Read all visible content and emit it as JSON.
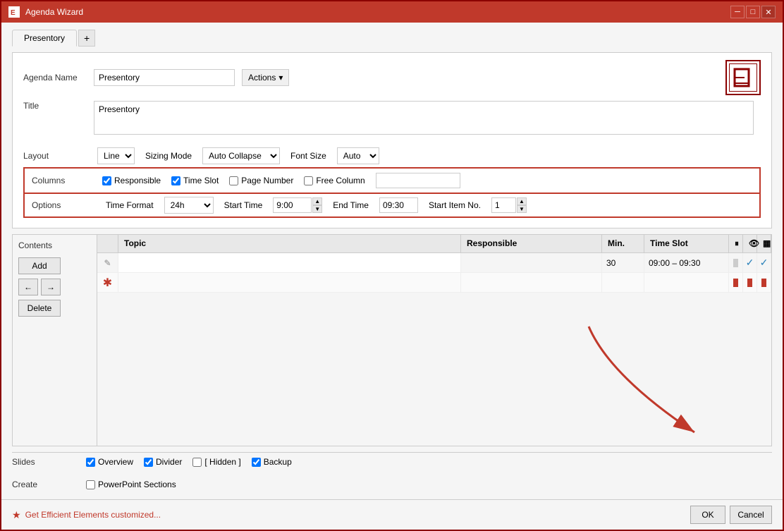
{
  "window": {
    "title": "Agenda Wizard",
    "title_icon": "E",
    "min_btn": "─",
    "max_btn": "□",
    "close_btn": "✕"
  },
  "tabs": [
    {
      "label": "Presentory",
      "active": true
    }
  ],
  "add_tab_label": "+",
  "form": {
    "agenda_name_label": "Agenda Name",
    "agenda_name_value": "Presentory",
    "actions_label": "Actions",
    "actions_arrow": "▾",
    "title_label": "Title",
    "title_value": "Presentory"
  },
  "layout": {
    "label": "Layout",
    "layout_value": "Line",
    "sizing_mode_label": "Sizing Mode",
    "sizing_mode_value": "Auto Collapse",
    "font_size_label": "Font Size",
    "font_size_value": "Auto"
  },
  "columns": {
    "label": "Columns",
    "responsible_label": "Responsible",
    "responsible_checked": true,
    "time_slot_label": "Time Slot",
    "time_slot_checked": true,
    "page_number_label": "Page Number",
    "page_number_checked": false,
    "free_column_label": "Free Column",
    "free_column_checked": false,
    "free_column_input": ""
  },
  "options": {
    "label": "Options",
    "time_format_label": "Time Format",
    "time_format_value": "24h",
    "start_time_label": "Start Time",
    "start_time_value": "9:00",
    "end_time_label": "End Time",
    "end_time_value": "09:30",
    "start_item_label": "Start Item No.",
    "start_item_value": "1"
  },
  "contents": {
    "label": "Contents",
    "add_btn": "Add",
    "left_arrow": "←",
    "right_arrow": "→",
    "delete_btn": "Delete",
    "table_headers": {
      "icon_col": "",
      "topic_col": "Topic",
      "responsible_col": "Responsible",
      "min_col": "Min.",
      "time_slot_col": "Time Slot",
      "pause_col": "⏸",
      "eye_col": "👁",
      "grid_col": "▦"
    },
    "rows": [
      {
        "icon": "✎",
        "topic": "",
        "responsible": "",
        "min": "30",
        "time_slot": "09:00 – 09:30",
        "pause": false,
        "eye": true,
        "grid": true,
        "is_new": false
      },
      {
        "icon": "✱",
        "topic": "",
        "responsible": "",
        "min": "",
        "time_slot": "",
        "pause": false,
        "eye": false,
        "grid": false,
        "is_new": true
      }
    ]
  },
  "slides": {
    "label": "Slides",
    "overview_label": "Overview",
    "overview_checked": true,
    "divider_label": "Divider",
    "divider_checked": true,
    "hidden_label": "[ Hidden ]",
    "hidden_checked": false,
    "backup_label": "Backup",
    "backup_checked": true
  },
  "create": {
    "label": "Create",
    "powerpoint_sections_label": "PowerPoint Sections",
    "powerpoint_sections_checked": false
  },
  "footer": {
    "star_icon": "★",
    "link_text": "Get Efficient Elements customized...",
    "ok_label": "OK",
    "cancel_label": "Cancel"
  }
}
